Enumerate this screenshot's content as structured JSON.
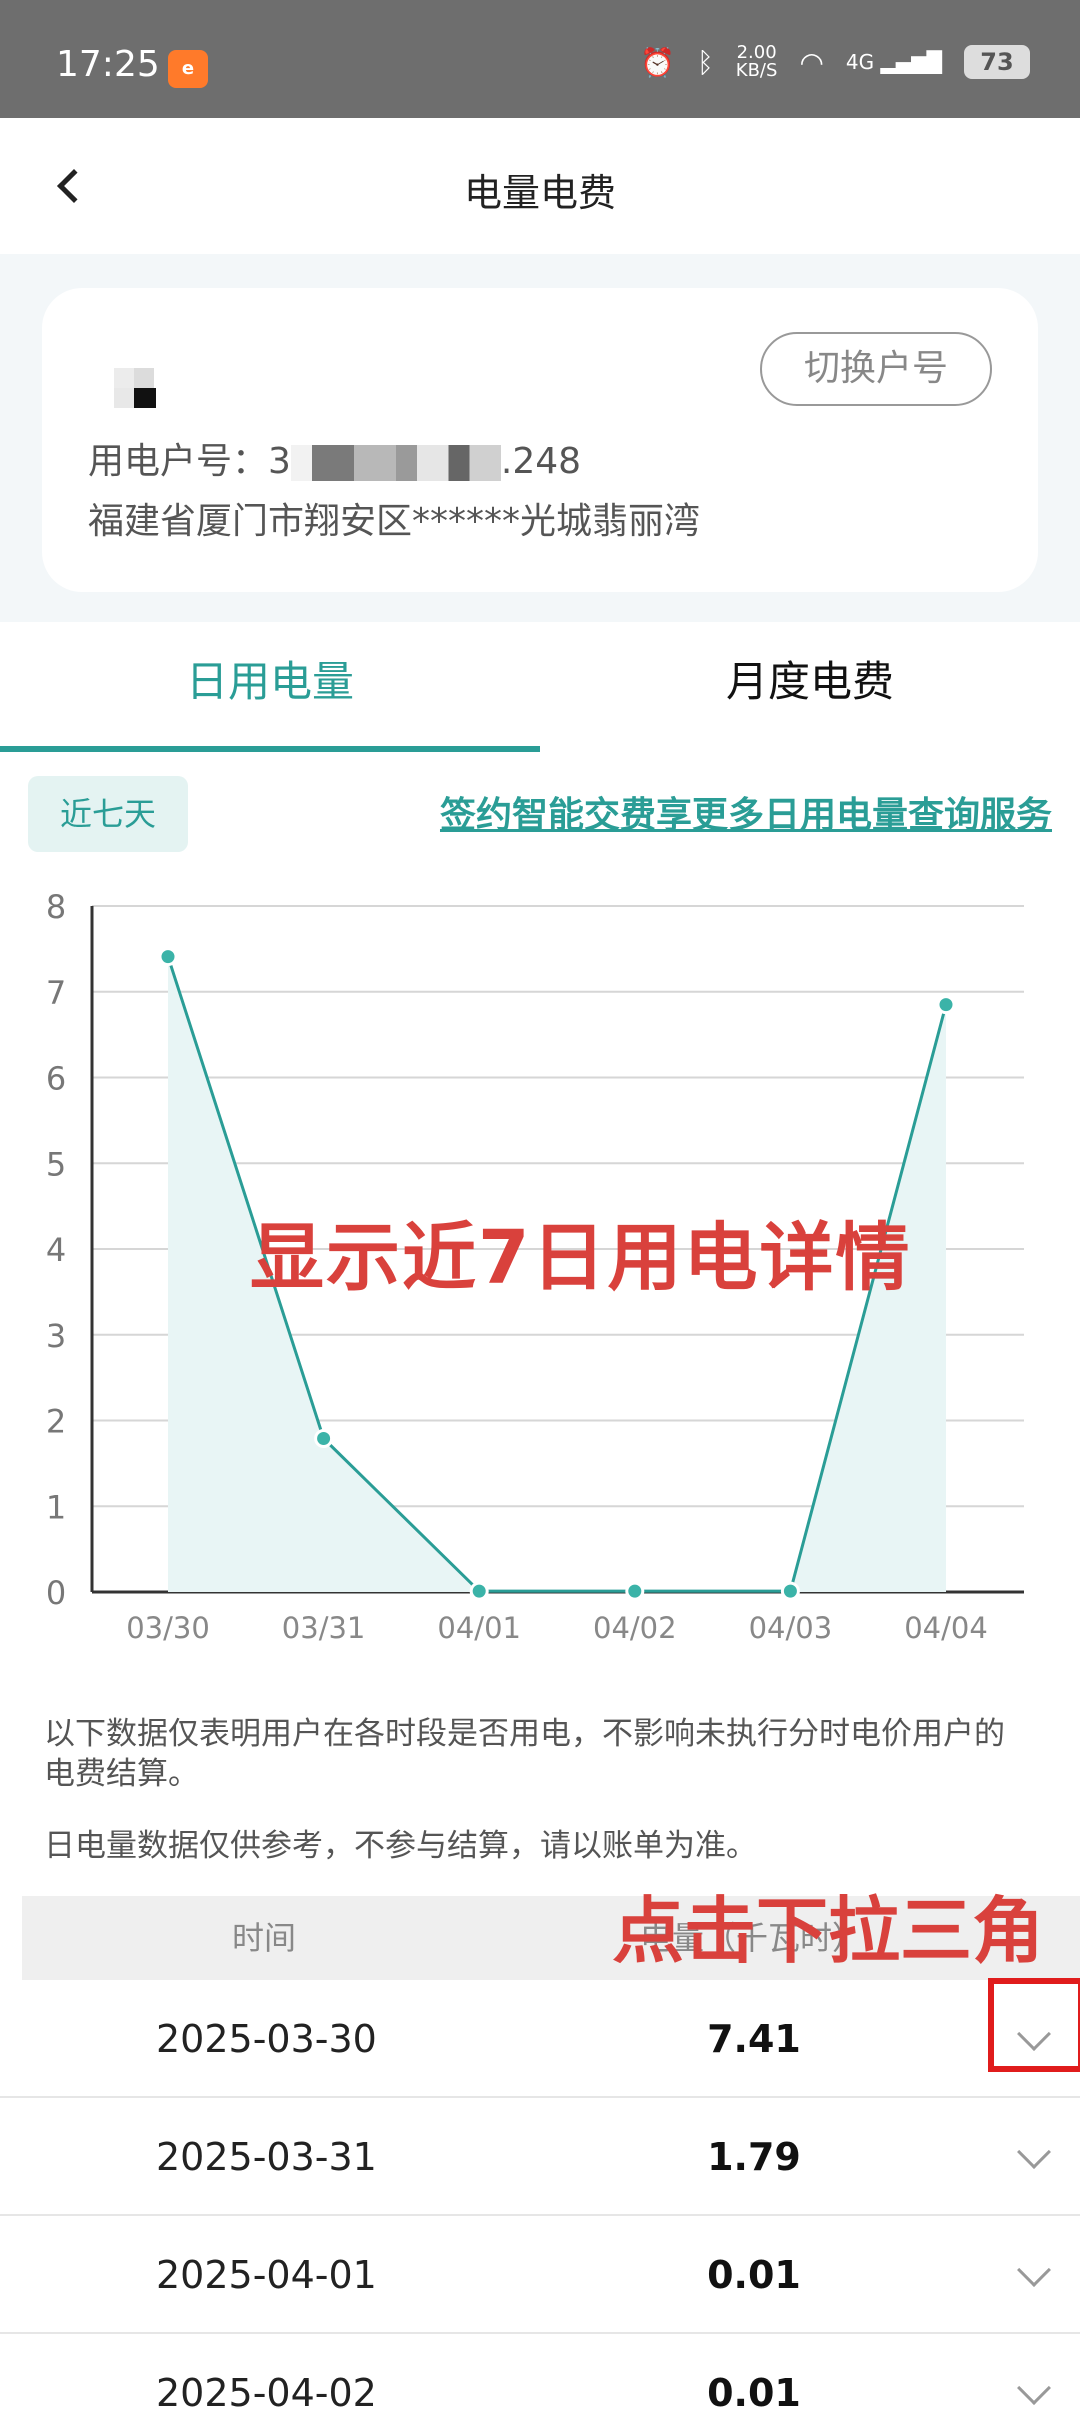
{
  "status_bar": {
    "time": "17:25",
    "speed_value": "2.00",
    "speed_unit": "KB/S",
    "network": "4G",
    "battery": "73"
  },
  "header": {
    "title": "电量电费",
    "back_icon": "chevron-left-icon"
  },
  "account": {
    "switch_label": "切换户号",
    "number_label": "用电户号：",
    "number_prefix": "3",
    "number_suffix": ".248",
    "address": "福建省厦门市翔安区******光城翡丽湾"
  },
  "tabs": {
    "daily": "日用电量",
    "monthly": "月度电费"
  },
  "filter": {
    "chip": "近七天",
    "promo": "签约智能交费享更多日用电量查询服务"
  },
  "annotations": {
    "chart_note": "显示近7日用电详情",
    "dropdown_note": "点击下拉三角"
  },
  "notes": {
    "line1": "以下数据仅表明用户在各时段是否用电，不影响未执行分时电价用户的电费结算。",
    "line2": "日电量数据仅供参考，不参与结算，请以账单为准。"
  },
  "table": {
    "col_time": "时间",
    "col_usage": "电量（千瓦时）",
    "rows": [
      {
        "date": "2025-03-30",
        "value": "7.41"
      },
      {
        "date": "2025-03-31",
        "value": "1.79"
      },
      {
        "date": "2025-04-01",
        "value": "0.01"
      },
      {
        "date": "2025-04-02",
        "value": "0.01"
      }
    ]
  },
  "colors": {
    "accent": "#2a9d96",
    "annotation": "#d9413c",
    "highlight": "#e01c1c"
  },
  "chart_data": {
    "type": "area",
    "categories": [
      "03/30",
      "03/31",
      "04/01",
      "04/02",
      "04/03",
      "04/04"
    ],
    "values": [
      7.41,
      1.79,
      0.01,
      0.01,
      0.01,
      6.85
    ],
    "ylim": [
      0,
      8
    ],
    "yticks": [
      "0",
      "1",
      "2",
      "3",
      "4",
      "5",
      "6",
      "7",
      "8"
    ],
    "grid": true
  }
}
